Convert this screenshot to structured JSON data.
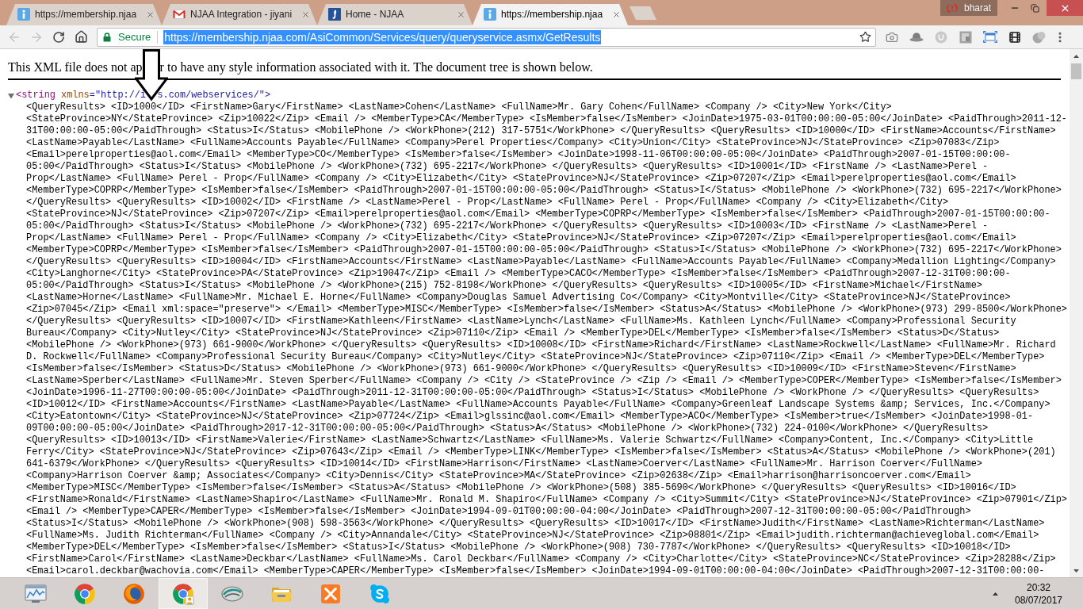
{
  "window": {
    "tabs": [
      {
        "kind": "info",
        "title": "https://membership.njaa",
        "selected": false
      },
      {
        "kind": "mail",
        "title": "NJAA Integration - jiyani",
        "selected": false
      },
      {
        "kind": "site",
        "title": "Home - NJAA",
        "selected": false
      },
      {
        "kind": "info",
        "title": "https://membership.njaa",
        "selected": true
      }
    ],
    "profile": {
      "name": "bharat"
    }
  },
  "toolbar": {
    "back_button": {
      "disabled": true
    },
    "forward_button": {
      "disabled": true
    },
    "address_bar": {
      "security_label": "Secure",
      "url": "https://membership.njaa.com/AsiCommon/Services/query/queryservice.asmx/GetResults",
      "url_selected": true
    }
  },
  "page": {
    "notice_before_arrow": "This XML file does not ap",
    "notice_after_arrow": "r to have any style information associated with it. The document tree is shown below.",
    "root_element": {
      "expanded": true,
      "tag": "<string",
      "attribute_name": "xmlns",
      "attribute_value_start": "=\"http://i",
      "attribute_value_end": "s.com/webservices/\">"
    },
    "text_lines": [
      "<QueryResults> <ID>1000</ID> <FirstName>Gary</FirstName> <LastName>Cohen</LastName> <FullName>Mr. Gary Cohen</FullName> <Company /> <City>New York</City>",
      "<StateProvince>NY</StateProvince> <Zip>10022</Zip> <Email /> <MemberType>CA</MemberType> <IsMember>false</IsMember> <JoinDate>1975-03-01T00:00:00-05:00</JoinDate> <PaidThrough>2011-12-",
      "31T00:00:00-05:00</PaidThrough> <Status>I</Status> <MobilePhone /> <WorkPhone>(212) 317-5751</WorkPhone> </QueryResults> <QueryResults> <ID>10000</ID> <FirstName>Accounts</FirstName>",
      "<LastName>Payable</LastName> <FullName>Accounts Payable</FullName> <Company>Perel Properties</Company> <City>Union</City> <StateProvince>NJ</StateProvince> <Zip>07083</Zip>",
      "<Email>perelproperties@aol.com</Email> <MemberType>CO</MemberType> <IsMember>false</IsMember> <JoinDate>1998-11-06T00:00:00-05:00</JoinDate> <PaidThrough>2007-01-15T00:00:00-",
      "05:00</PaidThrough> <Status>I</Status> <MobilePhone /> <WorkPhone>(732) 695-2217</WorkPhone> </QueryResults> <QueryResults> <ID>10001</ID> <FirstName /> <LastName>Perel -",
      "Prop</LastName> <FullName> Perel - Prop</FullName> <Company /> <City>Elizabeth</City> <StateProvince>NJ</StateProvince> <Zip>07207</Zip> <Email>perelproperties@aol.com</Email>",
      "<MemberType>COPRP</MemberType> <IsMember>false</IsMember> <PaidThrough>2007-01-15T00:00:00-05:00</PaidThrough> <Status>I</Status> <MobilePhone /> <WorkPhone>(732) 695-2217</WorkPhone>",
      "</QueryResults> <QueryResults> <ID>10002</ID> <FirstName /> <LastName>Perel - Prop</LastName> <FullName> Perel - Prop</FullName> <Company /> <City>Elizabeth</City>",
      "<StateProvince>NJ</StateProvince> <Zip>07207</Zip> <Email>perelproperties@aol.com</Email> <MemberType>COPRP</MemberType> <IsMember>false</IsMember> <PaidThrough>2007-01-15T00:00:00-",
      "05:00</PaidThrough> <Status>I</Status> <MobilePhone /> <WorkPhone>(732) 695-2217</WorkPhone> </QueryResults> <QueryResults> <ID>10003</ID> <FirstName /> <LastName>Perel -",
      "Prop</LastName> <FullName> Perel - Prop</FullName> <Company /> <City>Elizabeth</City> <StateProvince>NJ</StateProvince> <Zip>07207</Zip> <Email>perelproperties@aol.com</Email>",
      "<MemberType>COPRP</MemberType> <IsMember>false</IsMember> <PaidThrough>2007-01-15T00:00:00-05:00</PaidThrough> <Status>I</Status> <MobilePhone /> <WorkPhone>(732) 695-2217</WorkPhone>",
      "</QueryResults> <QueryResults> <ID>10004</ID> <FirstName>Accounts</FirstName> <LastName>Payable</LastName> <FullName>Accounts Payable</FullName> <Company>Medallion Lighting</Company>",
      "<City>Langhorne</City> <StateProvince>PA</StateProvince> <Zip>19047</Zip> <Email /> <MemberType>CACO</MemberType> <IsMember>false</IsMember> <PaidThrough>2007-12-31T00:00:00-",
      "05:00</PaidThrough> <Status>I</Status> <MobilePhone /> <WorkPhone>(215) 752-8198</WorkPhone> </QueryResults> <QueryResults> <ID>10005</ID> <FirstName>Michael</FirstName>",
      "<LastName>Horne</LastName> <FullName>Mr. Michael E. Horne</FullName> <Company>Douglas Samuel Advertising Co</Company> <City>Montville</City> <StateProvince>NJ</StateProvince>",
      "<Zip>07045</Zip> <Email xml:space=\"preserve\"> </Email> <MemberType>MISC</MemberType> <IsMember>false</IsMember> <Status>A</Status> <MobilePhone /> <WorkPhone>(973) 299-8500</WorkPhone>",
      "</QueryResults> <QueryResults> <ID>10007</ID> <FirstName>Kathleen</FirstName> <LastName>Lynch</LastName> <FullName>Ms. Kathleen Lynch</FullName> <Company>Professional Security",
      "Bureau</Company> <City>Nutley</City> <StateProvince>NJ</StateProvince> <Zip>07110</Zip> <Email /> <MemberType>DEL</MemberType> <IsMember>false</IsMember> <Status>D</Status>",
      "<MobilePhone /> <WorkPhone>(973) 661-9000</WorkPhone> </QueryResults> <QueryResults> <ID>10008</ID> <FirstName>Richard</FirstName> <LastName>Rockwell</LastName> <FullName>Mr. Richard",
      "D. Rockwell</FullName> <Company>Professional Security Bureau</Company> <City>Nutley</City> <StateProvince>NJ</StateProvince> <Zip>07110</Zip> <Email /> <MemberType>DEL</MemberType>",
      "<IsMember>false</IsMember> <Status>D</Status> <MobilePhone /> <WorkPhone>(973) 661-9000</WorkPhone> </QueryResults> <QueryResults> <ID>10009</ID> <FirstName>Steven</FirstName>",
      "<LastName>Sperber</LastName> <FullName>Mr. Steven Sperber</FullName> <Company /> <City /> <StateProvince /> <Zip /> <Email /> <MemberType>COPER</MemberType> <IsMember>false</IsMember>",
      "<JoinDate>1996-11-27T00:00:00-05:00</JoinDate> <PaidThrough>2011-12-31T00:00:00-05:00</PaidThrough> <Status>I</Status> <MobilePhone /> <WorkPhone /> </QueryResults> <QueryResults>",
      "<ID>10012</ID> <FirstName>Accounts</FirstName> <LastName>Payable</LastName> <FullName>Accounts Payable</FullName> <Company>Greenleaf Landscape Systems &amp; Services, Inc.</Company>",
      "<City>Eatontown</City> <StateProvince>NJ</StateProvince> <Zip>07724</Zip> <Email>glssinc@aol.com</Email> <MemberType>ACO</MemberType> <IsMember>true</IsMember> <JoinDate>1998-01-",
      "09T00:00:00-05:00</JoinDate> <PaidThrough>2017-12-31T00:00:00-05:00</PaidThrough> <Status>A</Status> <MobilePhone /> <WorkPhone>(732) 224-0100</WorkPhone> </QueryResults>",
      "<QueryResults> <ID>10013</ID> <FirstName>Valerie</FirstName> <LastName>Schwartz</LastName> <FullName>Ms. Valerie Schwartz</FullName> <Company>Content, Inc.</Company> <City>Little",
      "Ferry</City> <StateProvince>NJ</StateProvince> <Zip>07643</Zip> <Email /> <MemberType>LINK</MemberType> <IsMember>false</IsMember> <Status>A</Status> <MobilePhone /> <WorkPhone>(201)",
      "641-6379</WorkPhone> </QueryResults> <QueryResults> <ID>10014</ID> <FirstName>Harrison</FirstName> <LastName>Coerver</LastName> <FullName>Mr. Harrison Coerver</FullName>",
      "<Company>Harrison Coerver &amp; Associates</Company> <City>Dennis</City> <StateProvince>MA</StateProvince> <Zip>02638</Zip> <Email>harrison@harrisoncoerver.com</Email>",
      "<MemberType>MISC</MemberType> <IsMember>false</IsMember> <Status>A</Status> <MobilePhone /> <WorkPhone>(508) 385-5690</WorkPhone> </QueryResults> <QueryResults> <ID>10016</ID>",
      "<FirstName>Ronald</FirstName> <LastName>Shapiro</LastName> <FullName>Mr. Ronald M. Shapiro</FullName> <Company /> <City>Summit</City> <StateProvince>NJ</StateProvince> <Zip>07901</Zip>",
      "<Email /> <MemberType>CAPER</MemberType> <IsMember>false</IsMember> <JoinDate>1994-09-01T00:00:00-04:00</JoinDate> <PaidThrough>2007-12-31T00:00:00-05:00</PaidThrough>",
      "<Status>I</Status> <MobilePhone /> <WorkPhone>(908) 598-3563</WorkPhone> </QueryResults> <QueryResults> <ID>10017</ID> <FirstName>Judith</FirstName> <LastName>Richterman</LastName>",
      "<FullName>Ms. Judith Richterman</FullName> <Company /> <City>Annandale</City> <StateProvince>NJ</StateProvince> <Zip>08801</Zip> <Email>judith.richterman@achieveglobal.com</Email>",
      "<MemberType>DEL</MemberType> <IsMember>false</IsMember> <Status>I</Status> <MobilePhone /> <WorkPhone>(908) 730-7787</WorkPhone> </QueryResults> <QueryResults> <ID>10018</ID>",
      "<FirstName>Carol</FirstName> <LastName>Deckbar</LastName> <FullName>Ms. Carol Deckbar</FullName> <Company /> <City>Charlotte</City> <StateProvince>NC</StateProvince> <Zip>28288</Zip>",
      "<Email>carol.deckbar@wachovia.com</Email> <MemberType>CAPER</MemberType> <IsMember>false</IsMember> <JoinDate>1994-09-01T00:00:00-04:00</JoinDate> <PaidThrough>2007-12-31T00:00:00-"
    ]
  },
  "taskbar": {
    "items": [
      {
        "kind": "monitor",
        "selected": false
      },
      {
        "kind": "chrome",
        "selected": false
      },
      {
        "kind": "firefox",
        "selected": false
      },
      {
        "kind": "chrome-profile",
        "selected": true
      },
      {
        "kind": "swoosh",
        "selected": false
      },
      {
        "kind": "folder",
        "selected": false
      },
      {
        "kind": "xampp",
        "selected": false
      },
      {
        "kind": "skype",
        "selected": false
      }
    ],
    "time": "20:32",
    "date": "08/07/2017"
  }
}
